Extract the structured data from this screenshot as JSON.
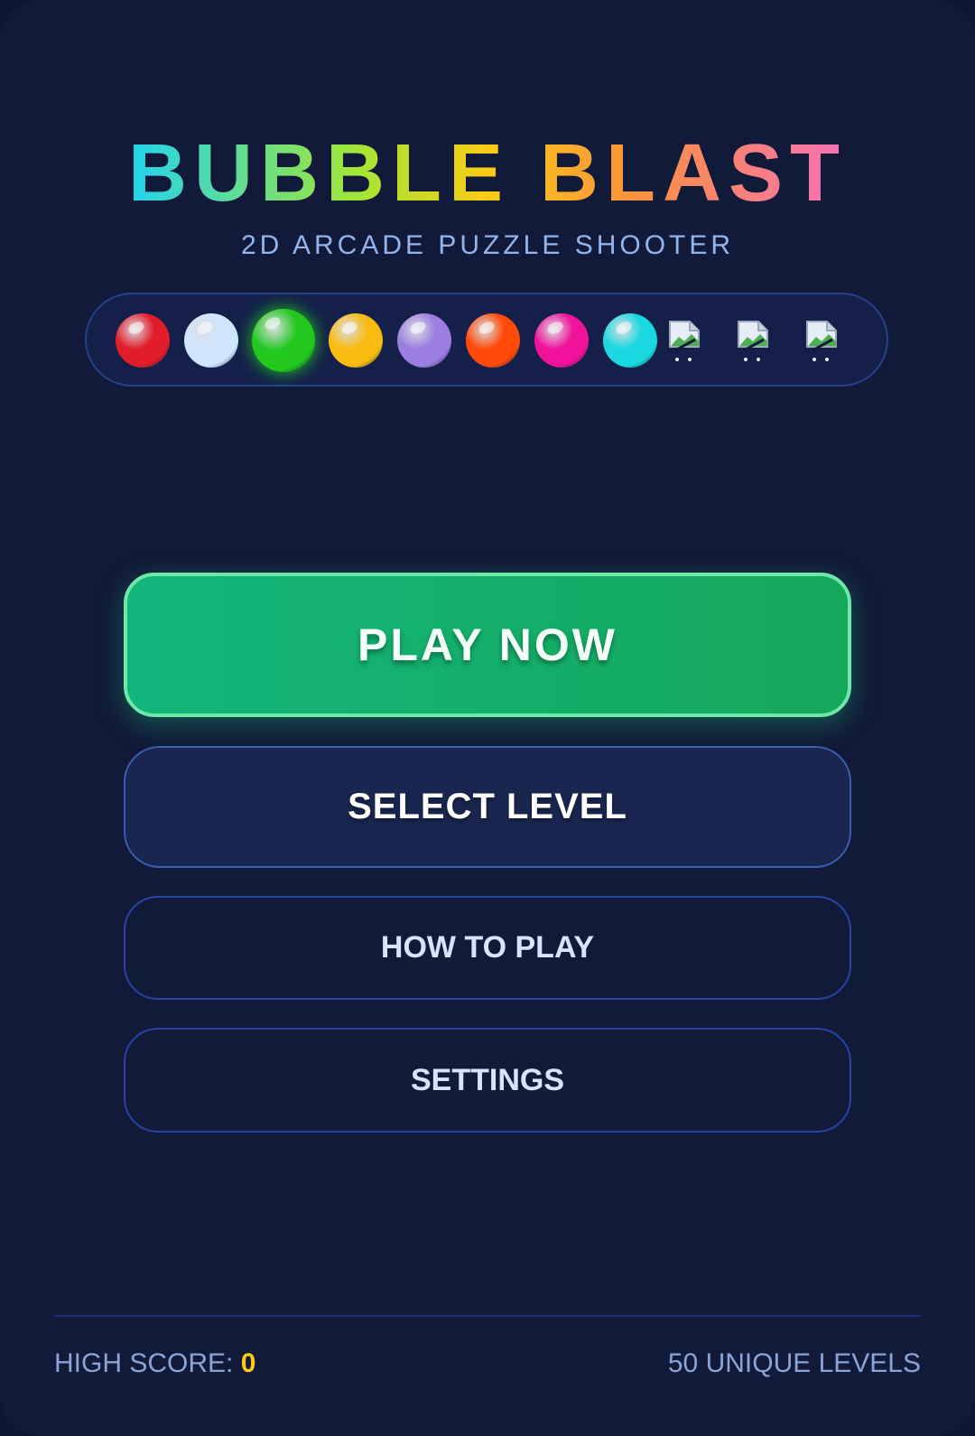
{
  "title": "BUBBLE BLAST",
  "subtitle": "2D ARCADE PUZZLE SHOOTER",
  "bubbles": [
    {
      "name": "red-bubble",
      "color": "#e11d2a"
    },
    {
      "name": "light-blue-bubble",
      "color": "#cfe6ff"
    },
    {
      "name": "green-bubble",
      "color": "#22c81e",
      "selected": true
    },
    {
      "name": "yellow-bubble",
      "color": "#f8bc10"
    },
    {
      "name": "purple-bubble",
      "color": "#9b7ee0"
    },
    {
      "name": "orange-bubble",
      "color": "#ff4a0a"
    },
    {
      "name": "pink-bubble",
      "color": "#f0129a"
    },
    {
      "name": "cyan-bubble",
      "color": "#1ad8e0"
    },
    {
      "name": "broken-image-icon"
    },
    {
      "name": "broken-image-icon"
    },
    {
      "name": "broken-image-icon"
    }
  ],
  "buttons": {
    "play": "PLAY NOW",
    "select_level": "SELECT LEVEL",
    "how_to_play": "HOW TO PLAY",
    "settings": "SETTINGS"
  },
  "footer": {
    "high_score_label": "HIGH SCORE:",
    "high_score_value": "0",
    "levels_text": "50 UNIQUE LEVELS"
  },
  "colors": {
    "background": "#111a38",
    "play_button": "#16a85a",
    "accent_score": "#facc15"
  }
}
